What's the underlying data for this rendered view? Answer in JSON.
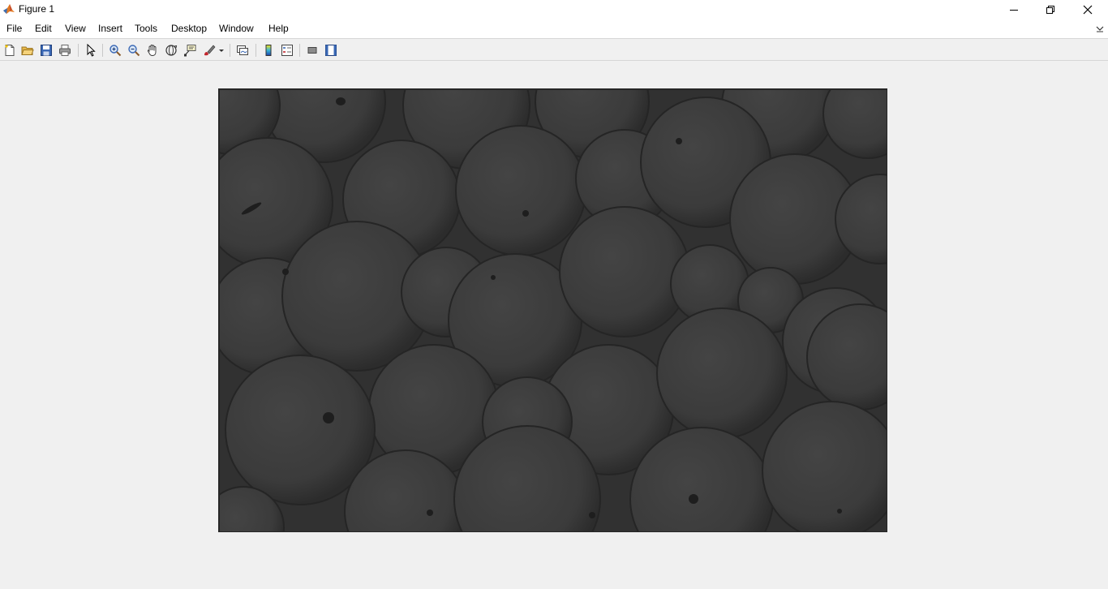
{
  "window": {
    "title": "Figure 1",
    "controls": [
      "minimize",
      "maximize",
      "close"
    ]
  },
  "menu": {
    "items": [
      "File",
      "Edit",
      "View",
      "Insert",
      "Tools",
      "Desktop",
      "Window",
      "Help"
    ]
  },
  "toolbar": {
    "buttons": [
      "new-figure-icon",
      "open-file-icon",
      "save-icon",
      "print-icon",
      "edit-plot-icon",
      "zoom-in-icon",
      "zoom-out-icon",
      "pan-icon",
      "rotate-3d-icon",
      "data-cursor-icon",
      "brush-icon",
      "link-plot-icon",
      "insert-colorbar-icon",
      "insert-legend-icon",
      "hide-plot-tools-icon",
      "show-plot-tools-icon"
    ]
  },
  "figure": {
    "image_subject": "grayscale photograph of oranges"
  },
  "colors": {
    "background": "#f0f0f0",
    "image_base": "#343434",
    "fruit": "#3c3c3c"
  }
}
